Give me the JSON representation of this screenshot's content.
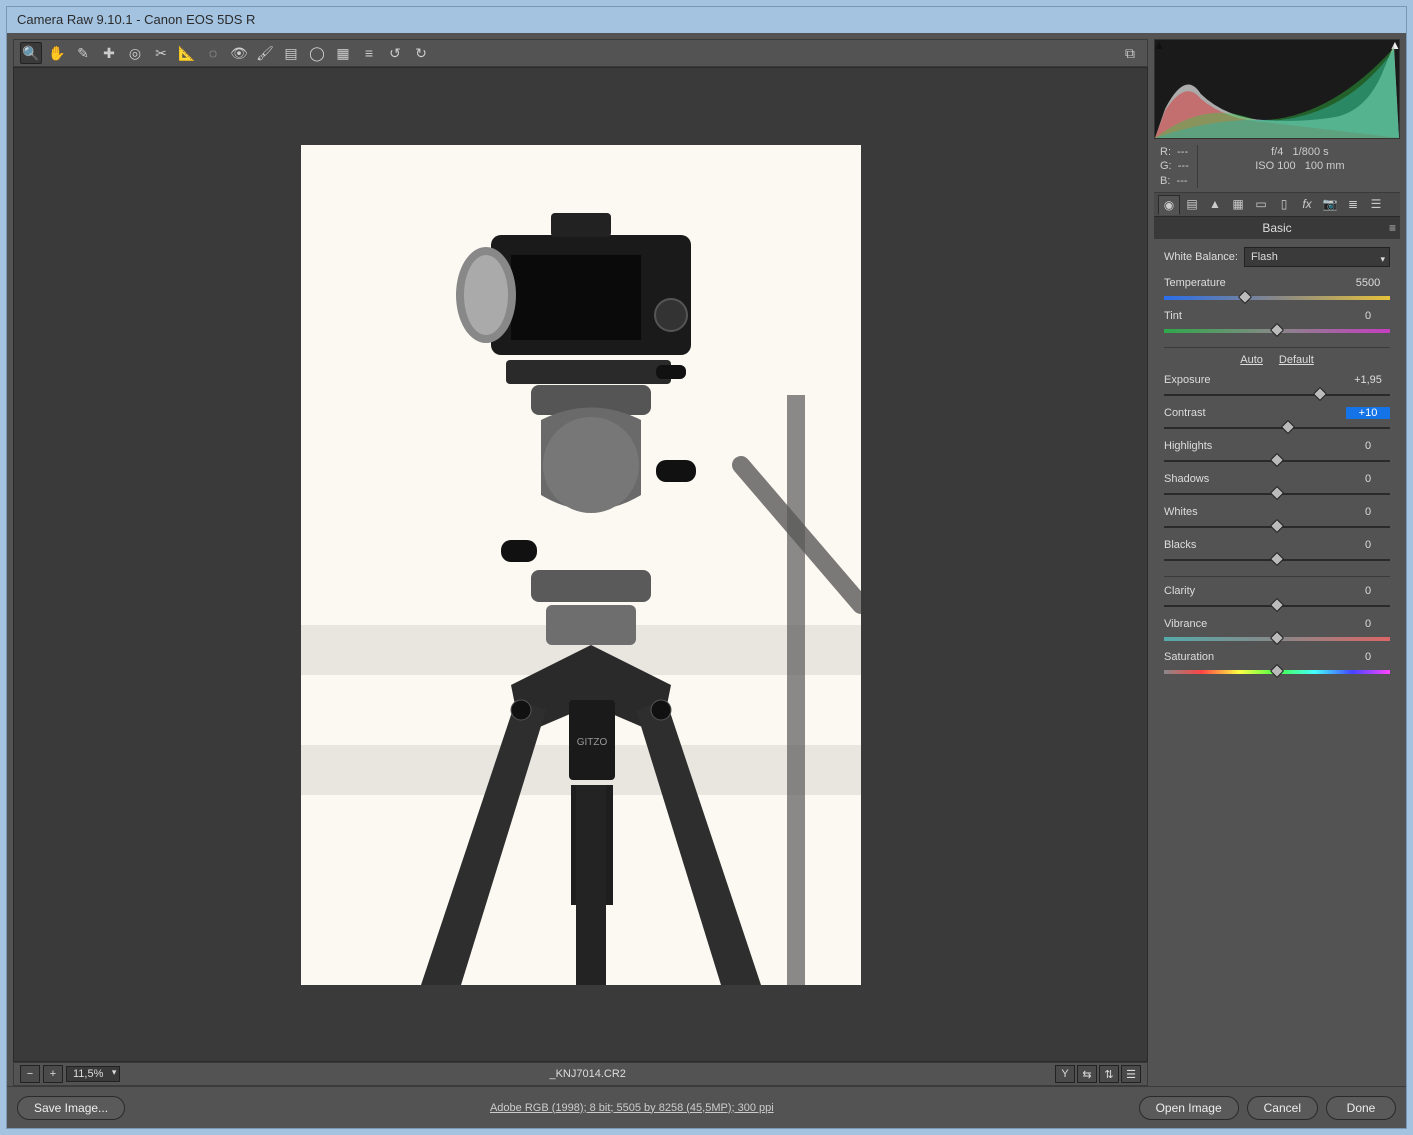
{
  "title": "Camera Raw 9.10.1  -  Canon EOS 5DS R",
  "toolbar_icons": [
    "zoom",
    "hand",
    "eyedropper-wb",
    "color-sampler",
    "target-adjust",
    "crop",
    "straighten",
    "spot-removal",
    "red-eye",
    "adjustment-brush",
    "graduated-filter",
    "radial-filter",
    "transform",
    "preferences",
    "menu",
    "rotate-left",
    "rotate-right"
  ],
  "toolbar_right_icon": "toggle-preview",
  "status": {
    "zoom_level": "11,5%",
    "filename": "_KNJ7014.CR2",
    "right_icons": [
      "Y",
      "compare-before-after",
      "swap-before-after",
      "settings"
    ]
  },
  "histogram": {
    "clip_left": "▲",
    "clip_right": "▲"
  },
  "rgb_info": {
    "r_label": "R:",
    "r_val": "---",
    "g_label": "G:",
    "g_val": "---",
    "b_label": "B:",
    "b_val": "---",
    "aperture": "f/4",
    "shutter": "1/800 s",
    "iso": "ISO 100",
    "focal": "100 mm"
  },
  "panel_tabs": [
    "basic",
    "tone-curve",
    "detail",
    "hsl",
    "split-toning",
    "lens",
    "fx",
    "camera",
    "presets",
    "snapshots"
  ],
  "panel_title": "Basic",
  "wb": {
    "label": "White Balance:",
    "value": "Flash"
  },
  "sliders": {
    "temperature": {
      "label": "Temperature",
      "value": "5500",
      "pos": 36,
      "grad": "temp-grad"
    },
    "tint": {
      "label": "Tint",
      "value": "0",
      "pos": 50,
      "grad": "tint-grad"
    },
    "exposure": {
      "label": "Exposure",
      "value": "+1,95",
      "pos": 69
    },
    "contrast": {
      "label": "Contrast",
      "value": "+10",
      "pos": 55,
      "selected": true
    },
    "highlights": {
      "label": "Highlights",
      "value": "0",
      "pos": 50
    },
    "shadows": {
      "label": "Shadows",
      "value": "0",
      "pos": 50
    },
    "whites": {
      "label": "Whites",
      "value": "0",
      "pos": 50
    },
    "blacks": {
      "label": "Blacks",
      "value": "0",
      "pos": 50
    },
    "clarity": {
      "label": "Clarity",
      "value": "0",
      "pos": 50
    },
    "vibrance": {
      "label": "Vibrance",
      "value": "0",
      "pos": 50,
      "grad": "vib-grad"
    },
    "saturation": {
      "label": "Saturation",
      "value": "0",
      "pos": 50,
      "grad": "sat-grad"
    }
  },
  "auto_label": "Auto",
  "default_label": "Default",
  "bottom": {
    "save_image": "Save Image...",
    "image_info": "Adobe RGB (1998); 8 bit; 5505 by 8258 (45,5MP); 300 ppi",
    "open_image": "Open Image",
    "cancel": "Cancel",
    "done": "Done"
  }
}
